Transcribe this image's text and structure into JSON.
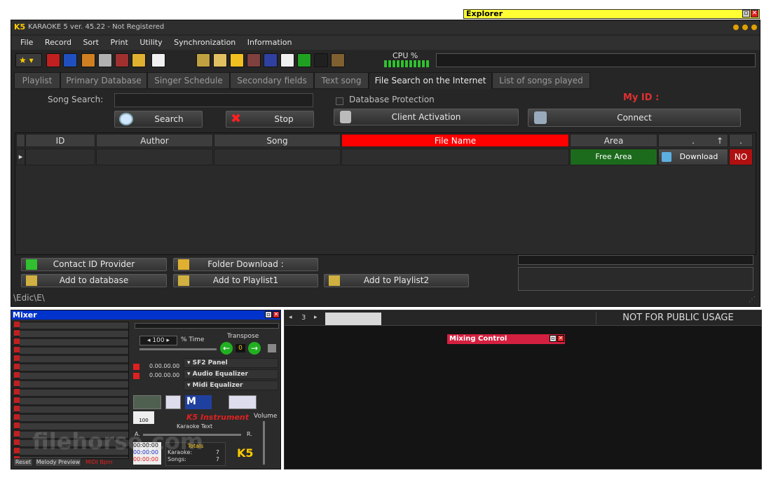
{
  "explorer": {
    "title": "Explorer"
  },
  "app": {
    "title": "KARAOKE 5   ver. 45.22 - Not Registered",
    "logo": "K5"
  },
  "menu": [
    "File",
    "Record",
    "Sort",
    "Print",
    "Utility",
    "Synchronization",
    "Information"
  ],
  "toolbar": {
    "cpu_label": "CPU %"
  },
  "tabs": [
    "Playlist",
    "Primary Database",
    "Singer Schedule",
    "Secondary fields",
    "Text song",
    "File Search on the Internet",
    "List of songs played"
  ],
  "active_tab": "File Search on the Internet",
  "search": {
    "label": "Song Search:",
    "value": "",
    "search_button": "Search",
    "stop_button": "Stop",
    "db_protection": "Database Protection",
    "client_activation": "Client Activation",
    "connect": "Connect",
    "my_id": "My ID :"
  },
  "grid": {
    "headers": [
      "ID",
      "Author",
      "Song",
      "File Name",
      "Area",
      ".",
      "."
    ],
    "row": {
      "area": "Free Area",
      "download": "Download",
      "status": "NO"
    }
  },
  "bottom": {
    "contact": "Contact ID Provider",
    "folder": "Folder Download :",
    "add_db": "Add to database",
    "add_pl1": "Add to Playlist1",
    "add_pl2": "Add to Playlist2",
    "path": "\\Edic\\E\\"
  },
  "mixer": {
    "title": "Mixer",
    "tempo_value": "100",
    "time_label": "% Time",
    "transpose_label": "Transpose",
    "transpose_value": "0",
    "time1": "0.00.00.00",
    "time2": "0.00.00.00",
    "sf2_panel": "SF2 Panel",
    "audio_eq": "Audio Equalizer",
    "midi_eq": "Midi Equalizer",
    "instrument": "K5 Instrument",
    "volume_label": "Volume",
    "karaoke_text": "Karaoke Text",
    "slider_a": "A.",
    "slider_r": "R.",
    "totals_label": "Totals",
    "karaoke_label": "Karaoke:",
    "karaoke_count": "7",
    "songs_label": "Songs:",
    "songs_count": "7",
    "clock1": "00:00:00",
    "clock2": "00:00:00",
    "clock3": "00:00:00",
    "reset": "Reset",
    "melody_preview": "Melody Preview",
    "midi_bpm": "MIDI Bpm",
    "gauge_value": "100"
  },
  "right_panel": {
    "page_num": "3",
    "notice": "NOT FOR PUBLIC USAGE",
    "mixing_control": "Mixing Control"
  },
  "watermark": "filehorse.com",
  "colors": {
    "explorer_bg": "#ffff33",
    "file_name_header": "#ff0000",
    "free_area": "#1c6a1c",
    "no_badge": "#b01010",
    "my_id": "#e03030",
    "mixer_title": "#0033cc",
    "mixing_control": "#d42040"
  }
}
